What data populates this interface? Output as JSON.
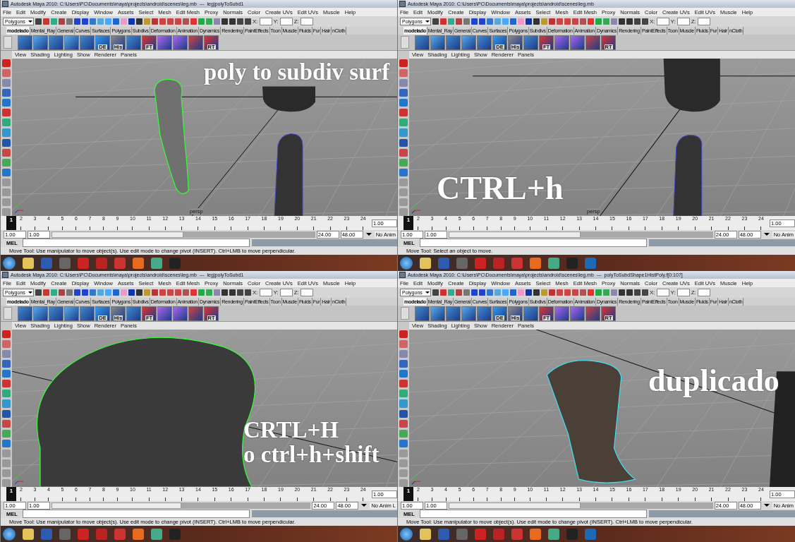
{
  "panels": [
    {
      "title": "Autodesk Maya 2010: C:\\Users\\PC\\Documents\\maya\\projects\\android\\scenes\\leg.mb  ---  leg|polyToSubd1",
      "menu": [
        "File",
        "Edit",
        "Modify",
        "Create",
        "Display",
        "Window",
        "Assets",
        "Select",
        "Mesh",
        "Edit Mesh",
        "Proxy",
        "Normals",
        "Color",
        "Create UVs",
        "Edit UVs",
        "Muscle",
        "Help"
      ],
      "mode": "Polygons",
      "coords": [
        "X:",
        "Y:",
        "Z:"
      ],
      "shelf_tabs": [
        {
          "label": "modelado",
          "selected": true
        },
        {
          "label": "Mental_Ray",
          "selected": false
        },
        {
          "label": "General",
          "selected": false
        },
        {
          "label": "Curves",
          "selected": false
        },
        {
          "label": "Surfaces",
          "selected": false
        },
        {
          "label": "Polygons",
          "selected": false
        },
        {
          "label": "Subdivs",
          "selected": false
        },
        {
          "label": "Deformation",
          "selected": false
        },
        {
          "label": "Animation",
          "selected": false
        },
        {
          "label": "Dynamics",
          "selected": false
        },
        {
          "label": "Rendering",
          "selected": false
        },
        {
          "label": "PaintEffects",
          "selected": false
        },
        {
          "label": "Toon",
          "selected": false
        },
        {
          "label": "Muscle",
          "selected": false
        },
        {
          "label": "Fluids",
          "selected": false
        },
        {
          "label": "Fur",
          "selected": false
        },
        {
          "label": "Hair",
          "selected": false
        },
        {
          "label": "nCloth",
          "selected": false
        }
      ],
      "shelf_labels": [
        "DE",
        "His",
        "FT",
        "RT"
      ],
      "view_menu": [
        "View",
        "Shading",
        "Lighting",
        "Show",
        "Renderer",
        "Panels"
      ],
      "caption": [
        "poly to subdiv surf"
      ],
      "camera": "persp",
      "time_slider": {
        "level": 0
      },
      "range_slider": {
        "level": 0.5
      },
      "current_frame": "1",
      "frames": [
        "2",
        "3",
        "4",
        "5",
        "6",
        "7",
        "8",
        "9",
        "10",
        "11",
        "12",
        "13",
        "14",
        "15",
        "16",
        "17",
        "18",
        "19",
        "20",
        "21",
        "22",
        "23",
        "24"
      ],
      "current_time": "1.00",
      "range": [
        "1.00",
        "1.00",
        "24.00",
        "48.00"
      ],
      "anim_layer": "No Anim",
      "command_label": "MEL",
      "help": "Move Tool: Use manipulator to move object(s). Use edit mode to change pivot (INSERT).  Ctrl+LMB to move perpendicular."
    },
    {
      "title": "Autodesk Maya 2010: C:\\Users\\PC\\Documents\\maya\\projects\\android\\scenes\\leg.mb",
      "menu": [
        "File",
        "Edit",
        "Modify",
        "Create",
        "Display",
        "Window",
        "Assets",
        "Select",
        "Mesh",
        "Edit Mesh",
        "Proxy",
        "Normals",
        "Color",
        "Create UVs",
        "Edit UVs",
        "Muscle",
        "Help"
      ],
      "mode": "Polygons",
      "coords": [
        "X:",
        "Y:",
        "Z:"
      ],
      "shelf_tabs": [
        {
          "label": "modelado",
          "selected": true
        },
        {
          "label": "Mental_Ray",
          "selected": false
        },
        {
          "label": "General",
          "selected": false
        },
        {
          "label": "Curves",
          "selected": false
        },
        {
          "label": "Surfaces",
          "selected": false
        },
        {
          "label": "Polygons",
          "selected": false
        },
        {
          "label": "Subdivs",
          "selected": false
        },
        {
          "label": "Deformation",
          "selected": false
        },
        {
          "label": "Animation",
          "selected": false
        },
        {
          "label": "Dynamics",
          "selected": false
        },
        {
          "label": "Rendering",
          "selected": false
        },
        {
          "label": "PaintEffects",
          "selected": false
        },
        {
          "label": "Toon",
          "selected": false
        },
        {
          "label": "Muscle",
          "selected": false
        },
        {
          "label": "Fluids",
          "selected": false
        },
        {
          "label": "Fur",
          "selected": false
        },
        {
          "label": "Hair",
          "selected": false
        },
        {
          "label": "nCloth",
          "selected": false
        }
      ],
      "shelf_labels": [
        "DE",
        "His",
        "FT",
        "RT"
      ],
      "view_menu": [
        "View",
        "Shading",
        "Lighting",
        "Show",
        "Renderer",
        "Panels"
      ],
      "caption": [
        "CTRL+h"
      ],
      "camera": "persp",
      "time_slider": {
        "level": 0
      },
      "range_slider": {
        "level": 0.5
      },
      "current_frame": "1",
      "frames": [
        "2",
        "3",
        "4",
        "5",
        "6",
        "7",
        "8",
        "9",
        "10",
        "11",
        "12",
        "13",
        "14",
        "15",
        "16",
        "17",
        "18",
        "19",
        "20",
        "21",
        "22",
        "23",
        "24"
      ],
      "current_time": "1.00",
      "range": [
        "1.00",
        "1.00",
        "24.00",
        "48.00"
      ],
      "anim_layer": "No Anim",
      "command_label": "MEL",
      "help": "Move Tool: Select an object to move."
    },
    {
      "title": "Autodesk Maya 2010: C:\\Users\\PC\\Documents\\maya\\projects\\android\\scenes\\leg.mb  ---  leg|polyToSubd1",
      "menu": [
        "File",
        "Edit",
        "Modify",
        "Create",
        "Display",
        "Window",
        "Assets",
        "Select",
        "Mesh",
        "Edit Mesh",
        "Proxy",
        "Normals",
        "Color",
        "Create UVs",
        "Edit UVs",
        "Muscle",
        "Help"
      ],
      "mode": "Polygons",
      "coords": [
        "X:",
        "Y:",
        "Z:"
      ],
      "shelf_tabs": [
        {
          "label": "modelado",
          "selected": true
        },
        {
          "label": "Mental_Ray",
          "selected": false
        },
        {
          "label": "General",
          "selected": false
        },
        {
          "label": "Curves",
          "selected": false
        },
        {
          "label": "Surfaces",
          "selected": false
        },
        {
          "label": "Polygons",
          "selected": false
        },
        {
          "label": "Subdivs",
          "selected": false
        },
        {
          "label": "Deformation",
          "selected": false
        },
        {
          "label": "Animation",
          "selected": false
        },
        {
          "label": "Dynamics",
          "selected": false
        },
        {
          "label": "Rendering",
          "selected": false
        },
        {
          "label": "PaintEffects",
          "selected": false
        },
        {
          "label": "Toon",
          "selected": false
        },
        {
          "label": "Muscle",
          "selected": false
        },
        {
          "label": "Fluids",
          "selected": false
        },
        {
          "label": "Fur",
          "selected": false
        },
        {
          "label": "Hair",
          "selected": false
        },
        {
          "label": "nCloth",
          "selected": false
        }
      ],
      "shelf_labels": [
        "DE",
        "His",
        "FT",
        "RT"
      ],
      "view_menu": [
        "View",
        "Shading",
        "Lighting",
        "Show",
        "Renderer",
        "Panels"
      ],
      "caption": [
        "CRTL+H",
        "o ctrl+h+shift"
      ],
      "time_slider": {
        "level": 0
      },
      "range_slider": {
        "level": 0.5
      },
      "current_frame": "1",
      "frames": [
        "2",
        "3",
        "4",
        "5",
        "6",
        "7",
        "8",
        "9",
        "10",
        "11",
        "12",
        "13",
        "14",
        "15",
        "16",
        "17",
        "18",
        "19",
        "20",
        "21",
        "22",
        "23",
        "24"
      ],
      "current_time": "1.00",
      "range": [
        "1.00",
        "1.00",
        "24.00",
        "48.00"
      ],
      "anim_layer": "No Anim L",
      "command_label": "MEL",
      "help": "Move Tool: Use manipulator to move object(s). Use edit mode to change pivot (INSERT).  Ctrl+LMB to move perpendicular."
    },
    {
      "title": "Autodesk Maya 2010: C:\\Users\\PC\\Documents\\maya\\projects\\android\\scenes\\leg.mb  ---  polyToSubdShape1HistPoly.f[0:107]",
      "menu": [
        "File",
        "Edit",
        "Modify",
        "Create",
        "Display",
        "Window",
        "Assets",
        "Select",
        "Mesh",
        "Edit Mesh",
        "Proxy",
        "Normals",
        "Color",
        "Create UVs",
        "Edit UVs",
        "Muscle",
        "Help"
      ],
      "mode": "Polygons",
      "coords": [
        "X:",
        "Y:",
        "Z:"
      ],
      "shelf_tabs": [
        {
          "label": "modelado",
          "selected": true
        },
        {
          "label": "Mental_Ray",
          "selected": false
        },
        {
          "label": "General",
          "selected": false
        },
        {
          "label": "Curves",
          "selected": false
        },
        {
          "label": "Surfaces",
          "selected": false
        },
        {
          "label": "Polygons",
          "selected": false
        },
        {
          "label": "Subdivs",
          "selected": false
        },
        {
          "label": "Deformation",
          "selected": false
        },
        {
          "label": "Animation",
          "selected": false
        },
        {
          "label": "Dynamics",
          "selected": false
        },
        {
          "label": "Rendering",
          "selected": false
        },
        {
          "label": "PaintEffects",
          "selected": false
        },
        {
          "label": "Toon",
          "selected": false
        },
        {
          "label": "Muscle",
          "selected": false
        },
        {
          "label": "Fluids",
          "selected": false
        },
        {
          "label": "Fur",
          "selected": false
        },
        {
          "label": "Hair",
          "selected": false
        },
        {
          "label": "nCloth",
          "selected": false
        }
      ],
      "shelf_labels": [
        "DE",
        "His",
        "FT",
        "RT"
      ],
      "view_menu": [
        "View",
        "Shading",
        "Lighting",
        "Show",
        "Renderer",
        "Panels"
      ],
      "caption": [
        "duplicado"
      ],
      "time_slider": {
        "level": 0
      },
      "range_slider": {
        "level": 0.5
      },
      "current_frame": "1",
      "frames": [
        "2",
        "3",
        "4",
        "5",
        "6",
        "7",
        "8",
        "9",
        "10",
        "11",
        "12",
        "13",
        "14",
        "15",
        "16",
        "17",
        "18",
        "19",
        "20",
        "21",
        "22",
        "23",
        "24"
      ],
      "current_time": "1.00",
      "range": [
        "1.00",
        "1.00",
        "24.00",
        "48.00"
      ],
      "anim_layer": "No Anim",
      "command_label": "MEL",
      "help": "Move Tool: Use manipulator to move object(s). Use edit mode to change pivot (INSERT).  Ctrl+LMB to move perpendicular."
    }
  ]
}
